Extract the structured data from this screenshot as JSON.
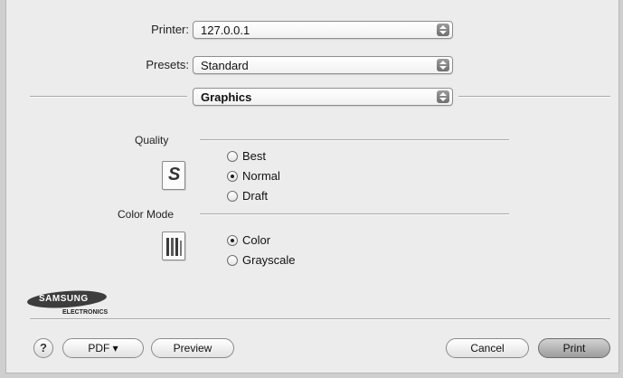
{
  "printer": {
    "label": "Printer:",
    "value": "127.0.0.1"
  },
  "presets": {
    "label": "Presets:",
    "value": "Standard"
  },
  "panel": {
    "value": "Graphics"
  },
  "quality": {
    "label": "Quality",
    "options": [
      {
        "label": "Best",
        "selected": false
      },
      {
        "label": "Normal",
        "selected": true
      },
      {
        "label": "Draft",
        "selected": false
      }
    ]
  },
  "color_mode": {
    "label": "Color Mode",
    "options": [
      {
        "label": "Color",
        "selected": true
      },
      {
        "label": "Grayscale",
        "selected": false
      }
    ]
  },
  "logo": {
    "brand": "SAMSUNG",
    "sub": "ELECTRONICS"
  },
  "buttons": {
    "help": "?",
    "pdf": "PDF ▾",
    "preview": "Preview",
    "cancel": "Cancel",
    "print": "Print"
  },
  "icons": {
    "quality_icon": "S",
    "popup_arrows": "updown-arrows-icon"
  }
}
